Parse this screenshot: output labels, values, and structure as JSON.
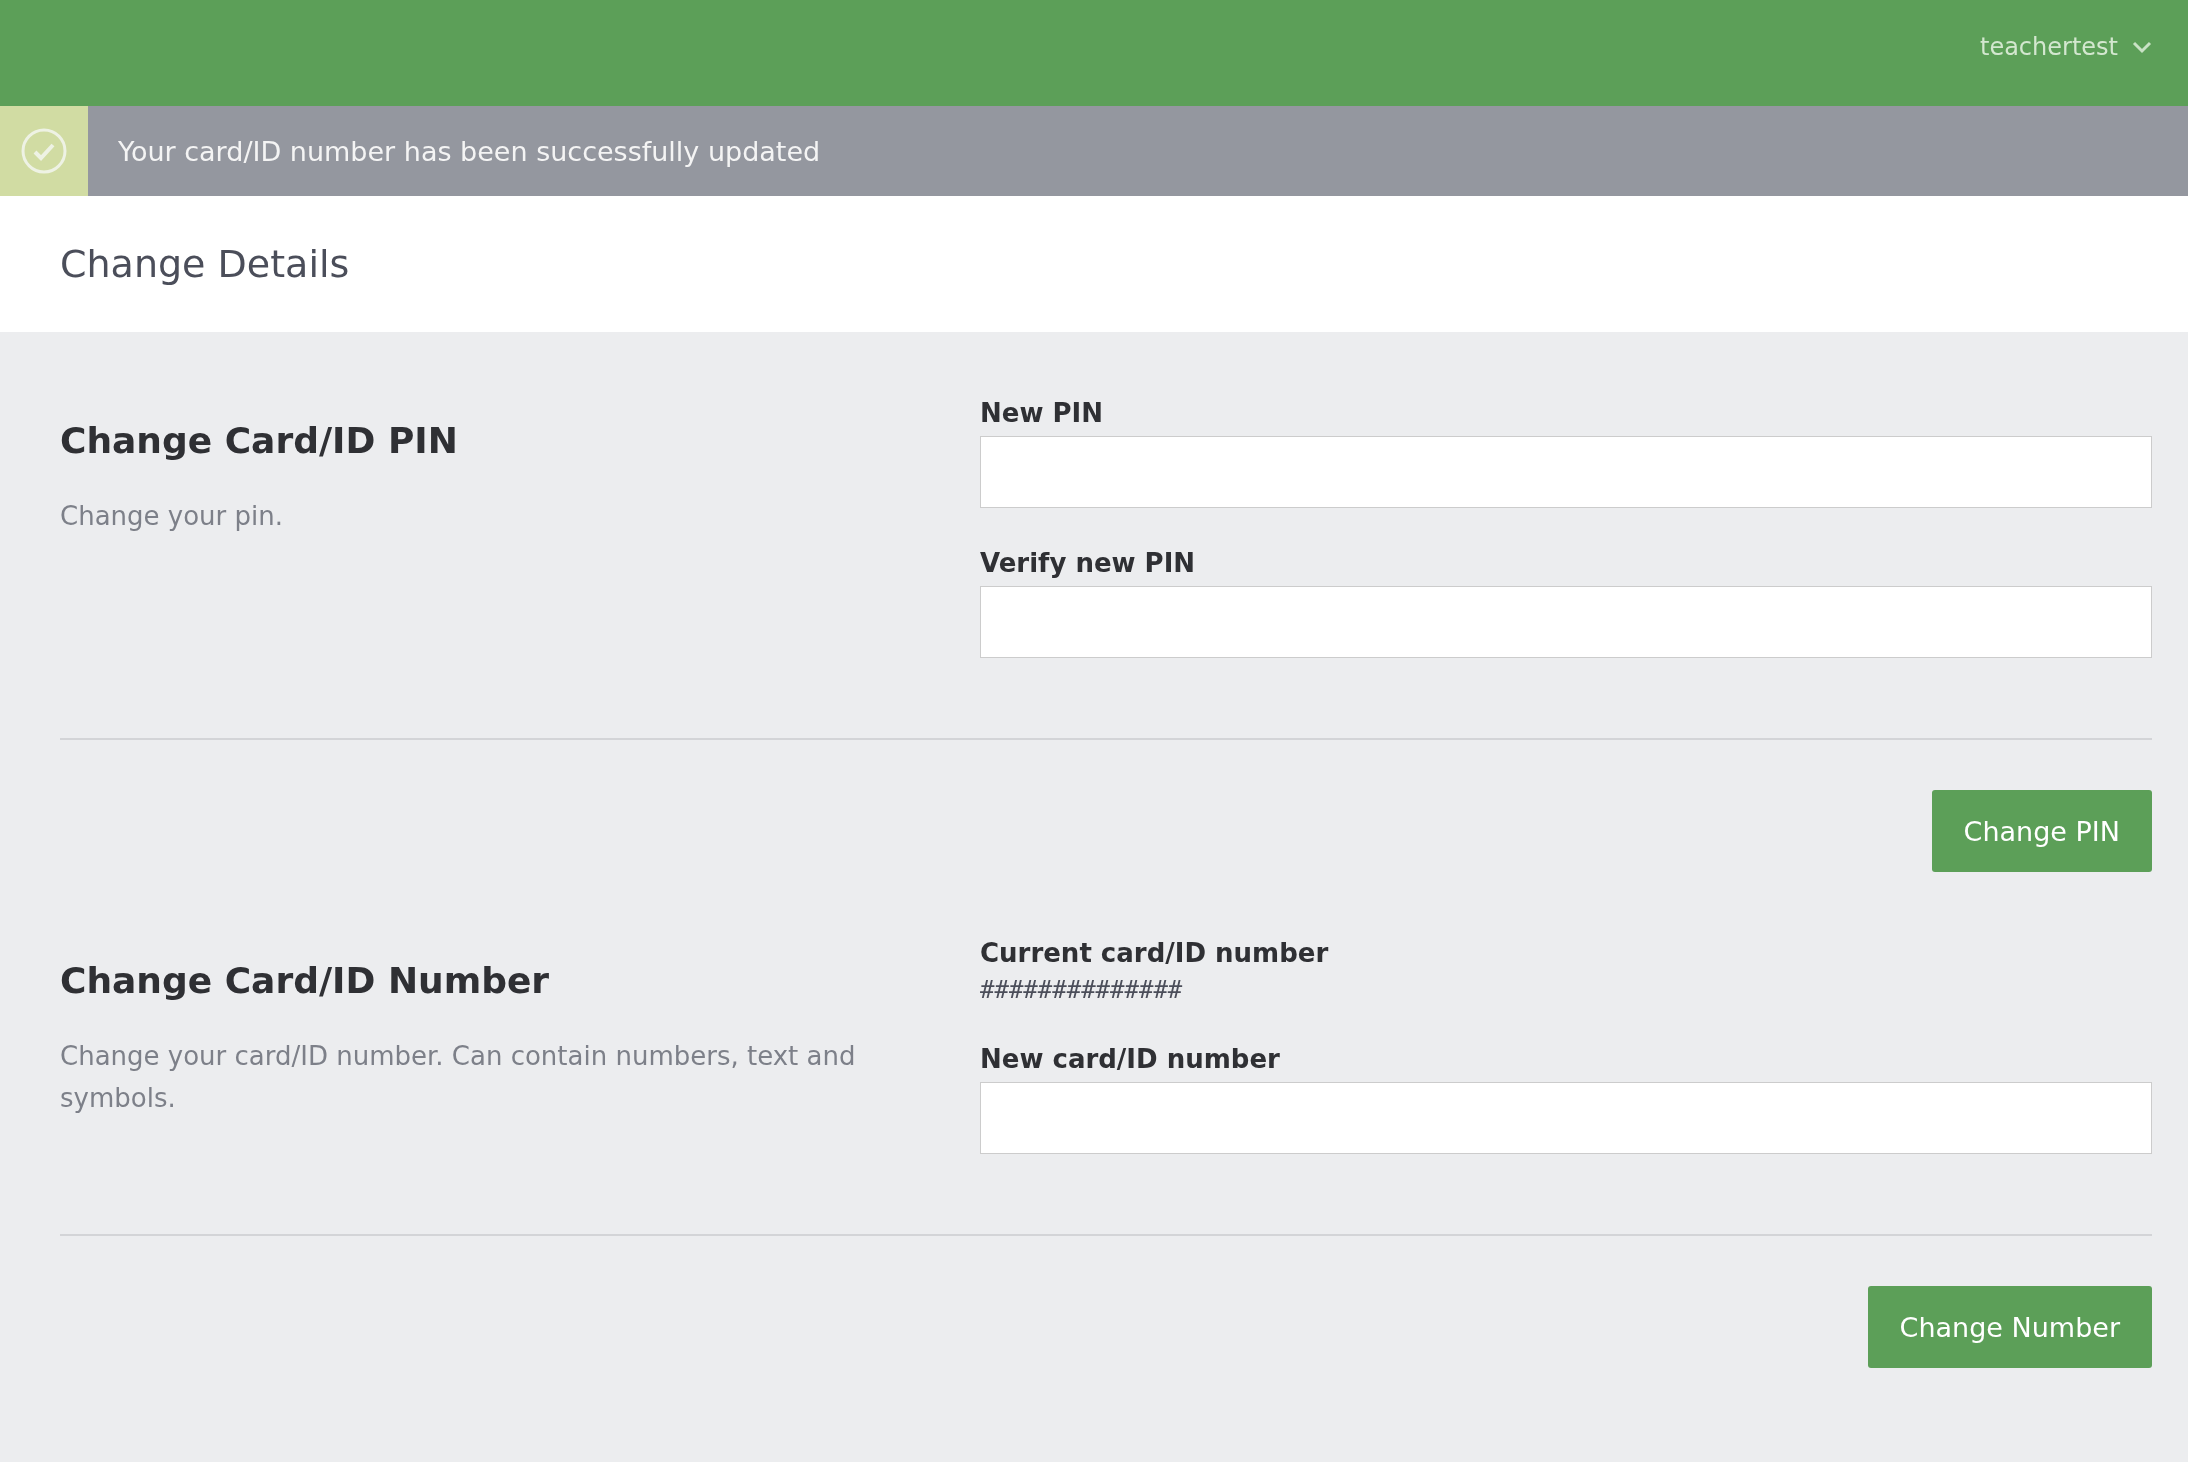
{
  "header": {
    "user_menu": {
      "label": "teachertest"
    }
  },
  "notification": {
    "message": "Your card/ID number has been successfully updated"
  },
  "page": {
    "title": "Change Details"
  },
  "sections": [
    {
      "title": "Change Card/ID PIN",
      "description": "Change your pin.",
      "fields": [
        {
          "kind": "input",
          "label": "New PIN"
        },
        {
          "kind": "input",
          "label": "Verify new PIN"
        }
      ],
      "button": "Change PIN"
    },
    {
      "title": "Change Card/ID Number",
      "description": "Change your card/ID number. Can contain numbers, text and symbols.",
      "fields": [
        {
          "kind": "readonly",
          "label": "Current card/ID number",
          "value": "##############"
        },
        {
          "kind": "input",
          "label": "New card/ID number"
        }
      ],
      "button": "Change Number"
    }
  ]
}
